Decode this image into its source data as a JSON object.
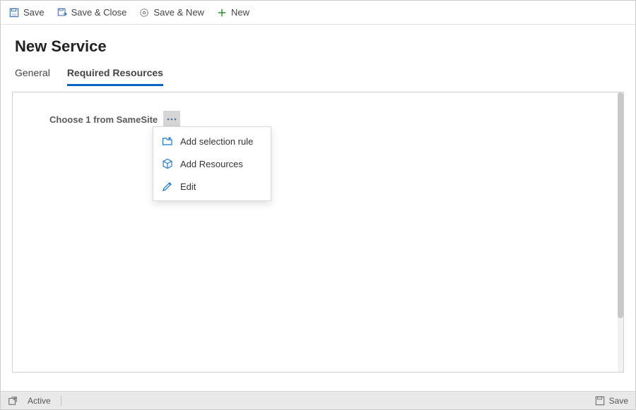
{
  "toolbar": {
    "save": "Save",
    "saveClose": "Save & Close",
    "saveNew": "Save & New",
    "new": "New"
  },
  "header": {
    "title": "New Service"
  },
  "tabs": {
    "general": "General",
    "required": "Required Resources"
  },
  "rule": {
    "label": "Choose 1 from SameSite"
  },
  "menu": {
    "addRule": "Add selection rule",
    "addResources": "Add Resources",
    "edit": "Edit"
  },
  "statusbar": {
    "state": "Active",
    "save": "Save"
  }
}
